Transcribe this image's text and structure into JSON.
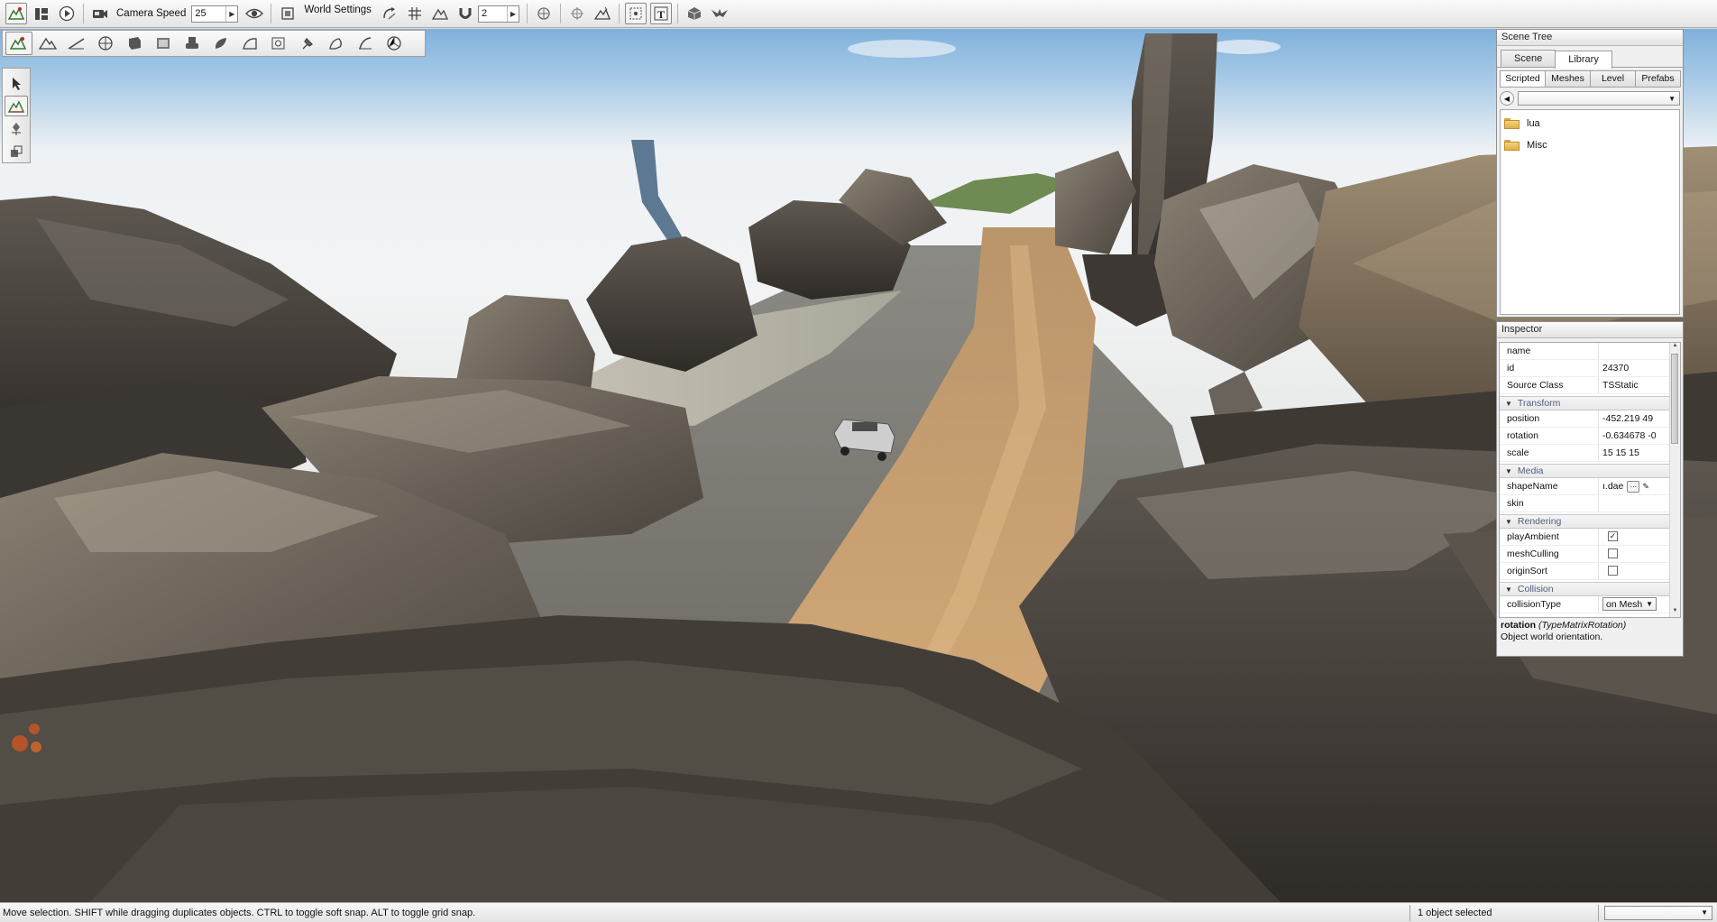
{
  "toolbar": {
    "camera_speed_label": "Camera Speed",
    "camera_speed_value": "25",
    "world_settings_label": "World Settings",
    "snap_value": "2"
  },
  "scene_tree": {
    "title": "Scene Tree",
    "tabs": [
      {
        "label": "Scene"
      },
      {
        "label": "Library",
        "active": true
      }
    ],
    "subtabs": [
      {
        "label": "Scripted",
        "active": true
      },
      {
        "label": "Meshes"
      },
      {
        "label": "Level"
      },
      {
        "label": "Prefabs"
      }
    ],
    "items": [
      {
        "label": "lua"
      },
      {
        "label": "Misc"
      }
    ]
  },
  "inspector": {
    "title": "Inspector",
    "fields": {
      "name": {
        "key": "name",
        "value": ""
      },
      "id": {
        "key": "id",
        "value": "24370"
      },
      "source_class": {
        "key": "Source Class",
        "value": "TSStatic"
      }
    },
    "sections": {
      "transform": {
        "label": "Transform",
        "position": {
          "key": "position",
          "value": "-452.219 49"
        },
        "rotation": {
          "key": "rotation",
          "value": "-0.634678 -0"
        },
        "scale": {
          "key": "scale",
          "value": "15 15 15"
        }
      },
      "media": {
        "label": "Media",
        "shape_name": {
          "key": "shapeName",
          "value": "ı.dae"
        },
        "skin": {
          "key": "skin",
          "value": ""
        }
      },
      "rendering": {
        "label": "Rendering",
        "play_ambient": {
          "key": "playAmbient",
          "checked": true
        },
        "mesh_culling": {
          "key": "meshCulling",
          "checked": false
        },
        "origin_sort": {
          "key": "originSort",
          "checked": false
        }
      },
      "collision": {
        "label": "Collision",
        "collision_type": {
          "key": "collisionType",
          "value": "on Mesh"
        }
      }
    },
    "description": {
      "field": "rotation",
      "type": "(TypeMatrixRotation)",
      "text": "Object world orientation."
    }
  },
  "status": {
    "message": "Move selection.  SHIFT while dragging duplicates objects.  CTRL to toggle soft snap.  ALT to toggle grid snap.",
    "selection": "1 object selected",
    "right_combo": ""
  },
  "icons": {
    "terrain": "terrain-editor-icon",
    "scene": "scene-view-icon",
    "play": "play-icon",
    "camera": "camera-icon",
    "eye": "visibility-icon",
    "magnet": "snap-magnet-icon"
  }
}
